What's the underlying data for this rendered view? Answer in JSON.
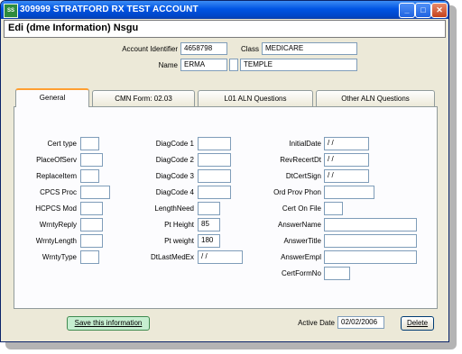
{
  "window": {
    "icon_text": "SS",
    "title": "309999 STRATFORD RX TEST ACCOUNT",
    "controls": {
      "minimize": "_",
      "maximize": "□",
      "close": "✕"
    }
  },
  "header": {
    "title": "Edi (dme Information) Nsgu"
  },
  "account": {
    "identifier_label": "Account Identifier",
    "identifier_value": "4658798",
    "class_label": "Class",
    "class_value": "MEDICARE",
    "name_label": "Name",
    "first_name": "ERMA",
    "middle_initial": "",
    "last_name": "TEMPLE"
  },
  "tabs": [
    {
      "label": "General",
      "active": true
    },
    {
      "label": "CMN Form: 02.03",
      "active": false
    },
    {
      "label": "L01 ALN Questions",
      "active": false
    },
    {
      "label": "Other ALN Questions",
      "active": false
    }
  ],
  "general": {
    "col1": [
      {
        "label": "Cert type",
        "value": ""
      },
      {
        "label": "PlaceOfServ",
        "value": ""
      },
      {
        "label": "ReplaceItem",
        "value": ""
      },
      {
        "label": "CPCS Proc",
        "value": ""
      },
      {
        "label": "HCPCS Mod",
        "value": ""
      },
      {
        "label": "WrntyReply",
        "value": ""
      },
      {
        "label": "WrntyLength",
        "value": ""
      },
      {
        "label": "WrntyType",
        "value": ""
      }
    ],
    "col2": [
      {
        "label": "DiagCode 1",
        "value": ""
      },
      {
        "label": "DiagCode 2",
        "value": ""
      },
      {
        "label": "DiagCode 3",
        "value": ""
      },
      {
        "label": "DiagCode 4",
        "value": ""
      },
      {
        "label": "LengthNeed",
        "value": ""
      },
      {
        "label": "Pt Height",
        "value": "85"
      },
      {
        "label": "Pt weight",
        "value": "180"
      },
      {
        "label": "DtLastMedEx",
        "value": " / /"
      }
    ],
    "col3": [
      {
        "label": "InitialDate",
        "value": " / /"
      },
      {
        "label": "RevRecertDt",
        "value": " / /"
      },
      {
        "label": "DtCertSign",
        "value": " / /"
      },
      {
        "label": "Ord Prov Phon",
        "value": ""
      },
      {
        "label": "Cert On File",
        "value": ""
      },
      {
        "label": "AnswerName",
        "value": ""
      },
      {
        "label": "AnswerTitle",
        "value": ""
      },
      {
        "label": "AnswerEmpl",
        "value": ""
      },
      {
        "label": "CertFormNo",
        "value": ""
      }
    ]
  },
  "footer": {
    "save_label": "Save this information",
    "active_date_label": "Active Date",
    "active_date_value": "02/02/2006",
    "delete_label": "Delete"
  }
}
